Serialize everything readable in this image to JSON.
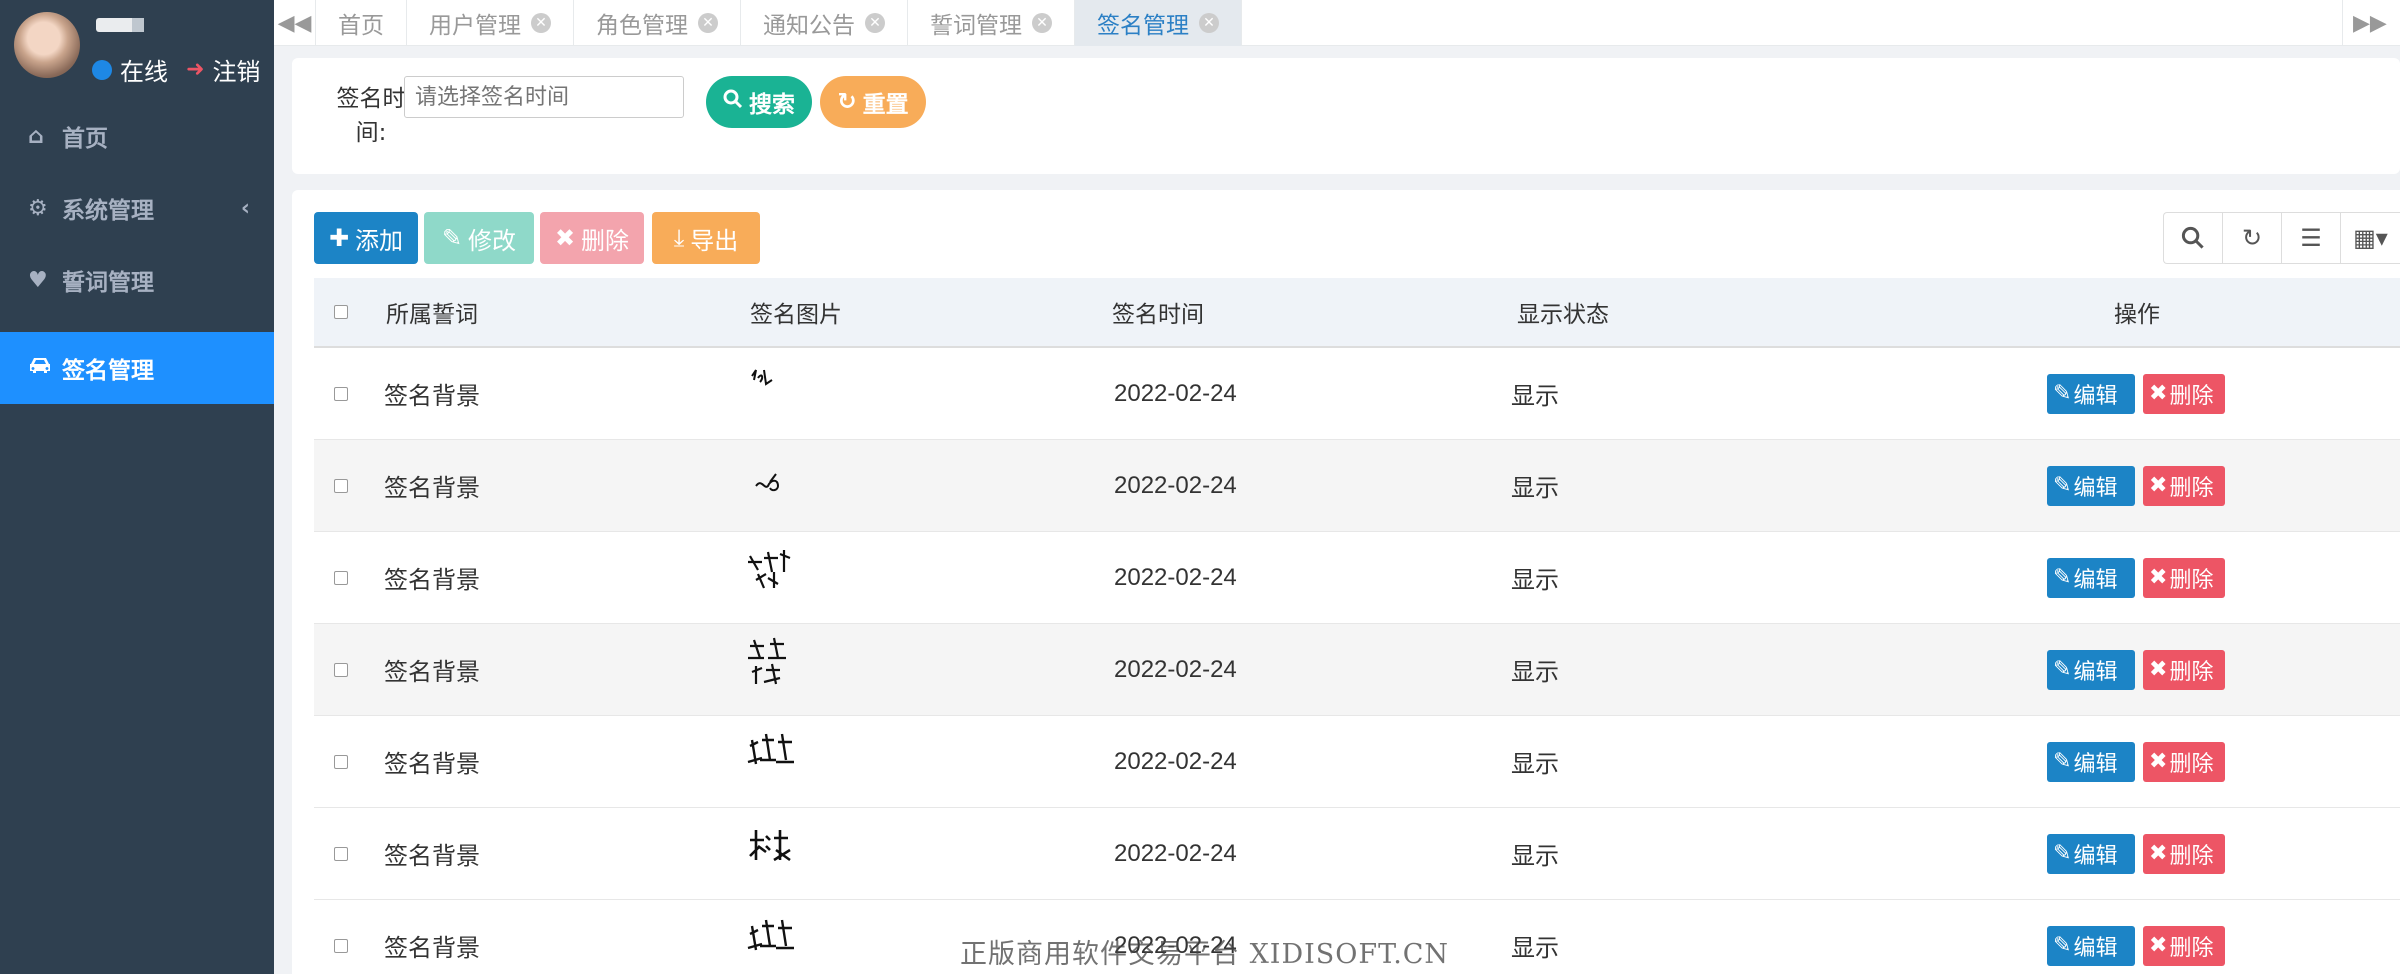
{
  "sidebar": {
    "status_online": "在线",
    "logout": "注销",
    "items": [
      {
        "label": "首页",
        "icon": "home-icon"
      },
      {
        "label": "系统管理",
        "icon": "gear-icon"
      },
      {
        "label": "誓词管理",
        "icon": "heart-icon"
      },
      {
        "label": "签名管理",
        "icon": "car-icon"
      }
    ]
  },
  "tabs": [
    {
      "label": "首页"
    },
    {
      "label": "用户管理"
    },
    {
      "label": "角色管理"
    },
    {
      "label": "通知公告"
    },
    {
      "label": "誓词管理"
    },
    {
      "label": "签名管理"
    }
  ],
  "search": {
    "label": "签名时间:",
    "placeholder": "请选择签名时间",
    "search_button": "搜索",
    "reset_button": "重置"
  },
  "toolbar": {
    "add": "添加",
    "edit": "修改",
    "delete": "删除",
    "export": "导出"
  },
  "table": {
    "headers": [
      "所属誓词",
      "签名图片",
      "签名时间",
      "显示状态",
      "操作"
    ],
    "edit_label": "编辑",
    "delete_label": "删除",
    "rows": [
      {
        "vow": "签名背景",
        "time": "2022-02-24",
        "status": "显示"
      },
      {
        "vow": "签名背景",
        "time": "2022-02-24",
        "status": "显示"
      },
      {
        "vow": "签名背景",
        "time": "2022-02-24",
        "status": "显示"
      },
      {
        "vow": "签名背景",
        "time": "2022-02-24",
        "status": "显示"
      },
      {
        "vow": "签名背景",
        "time": "2022-02-24",
        "status": "显示"
      },
      {
        "vow": "签名背景",
        "time": "2022-02-24",
        "status": "显示"
      },
      {
        "vow": "签名背景",
        "time": "2022-02-24",
        "status": "显示"
      }
    ]
  },
  "watermark": "正版商用软件交易平台 XIDISOFT.CN",
  "colors": {
    "sidebar_bg": "#2f4050",
    "active_menu": "#1e90ff",
    "primary": "#1c84c6",
    "success": "#1ab394",
    "warning": "#f8ac59",
    "danger": "#ed5565"
  }
}
